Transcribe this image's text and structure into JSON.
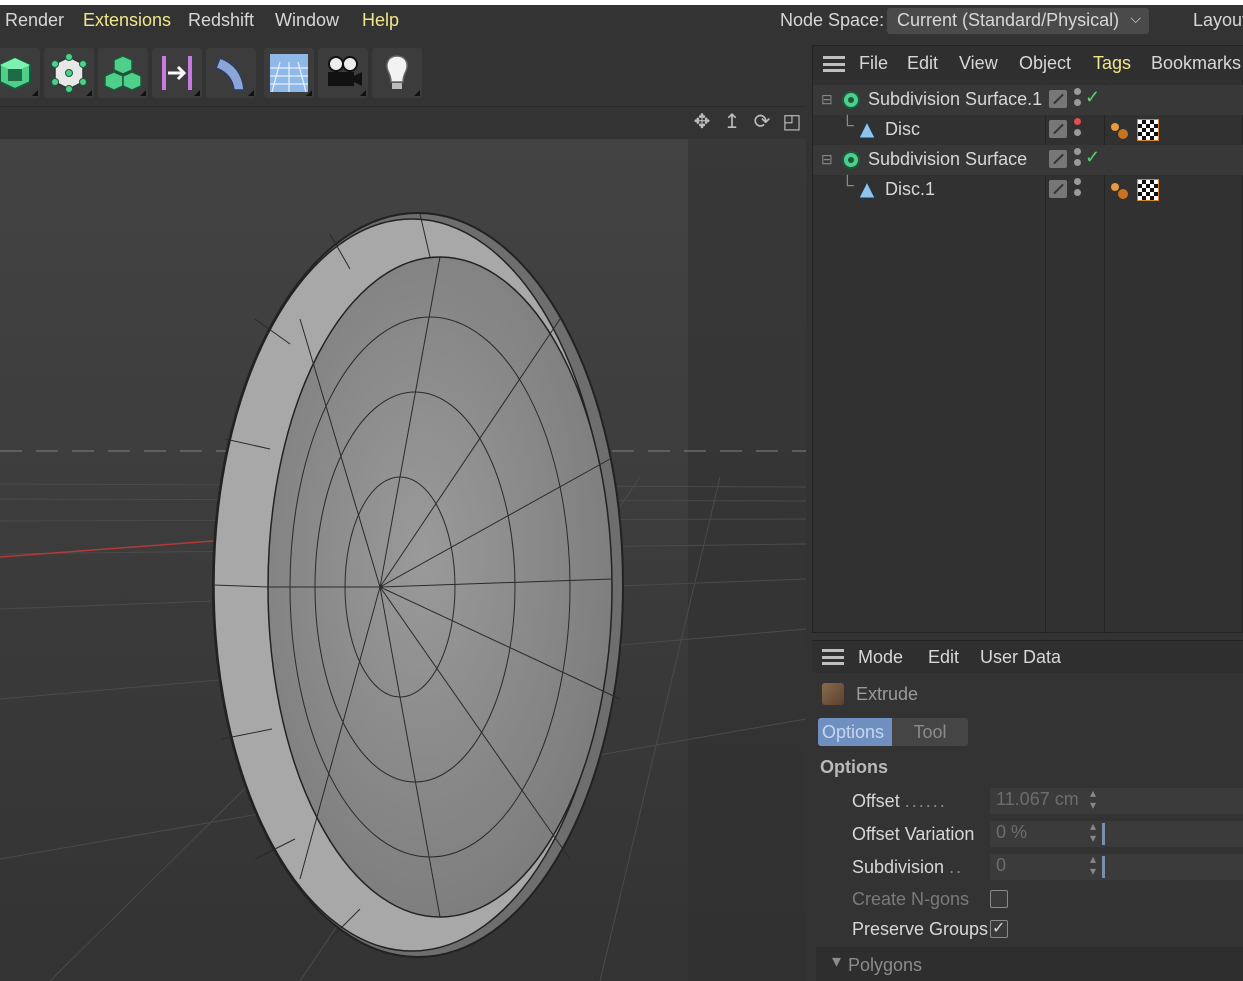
{
  "menubar": {
    "items": [
      "Render",
      "Extensions",
      "Redshift",
      "Window",
      "Help"
    ],
    "node_space_label": "Node Space:",
    "node_space_value": "Current (Standard/Physical)",
    "layout_label": "Layout"
  },
  "toolbar": {
    "tools": [
      "cube-icon",
      "polygon-mesh-icon",
      "cloner-icon",
      "spline-align-icon",
      "bend-deformer-icon",
      "floor-icon",
      "camera-icon",
      "light-icon"
    ]
  },
  "object_manager": {
    "menu": [
      "File",
      "Edit",
      "View",
      "Object",
      "Tags",
      "Bookmarks"
    ],
    "objects": [
      {
        "name": "Subdivision Surface.1",
        "level": 0
      },
      {
        "name": "Disc",
        "level": 1
      },
      {
        "name": "Subdivision Surface",
        "level": 0
      },
      {
        "name": "Disc.1",
        "level": 1
      }
    ]
  },
  "attribute_manager": {
    "menu": [
      "Mode",
      "Edit",
      "User Data"
    ],
    "tool_title": "Extrude",
    "tabs": [
      "Options",
      "Tool"
    ],
    "section": "Options",
    "fields": {
      "offset_label": "Offset",
      "offset_value": "11.067 cm",
      "offset_variation_label": "Offset Variation",
      "offset_variation_value": "0 %",
      "subdivision_label": "Subdivision",
      "subdivision_value": "0",
      "create_ngons_label": "Create N-gons",
      "create_ngons_checked": false,
      "preserve_groups_label": "Preserve Groups",
      "preserve_groups_checked": true
    },
    "collapsed_section": "Polygons"
  },
  "colors": {
    "highlight_menu": "#f0e68c",
    "active_tab": "#6e8fc0",
    "check_green": "#58d468"
  }
}
